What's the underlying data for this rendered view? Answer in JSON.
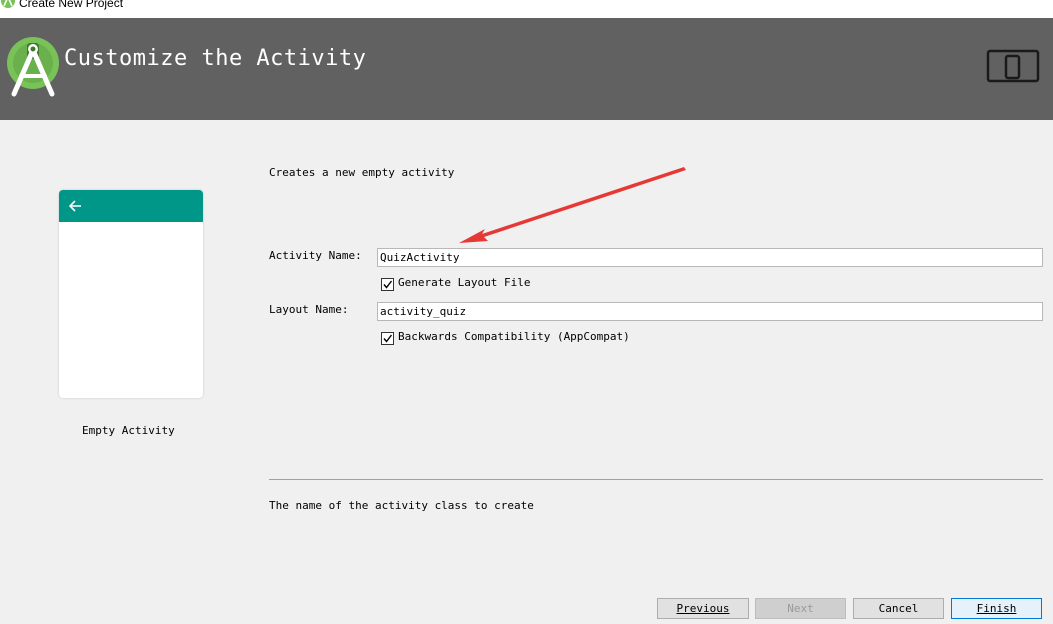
{
  "window": {
    "title": "Create New Project"
  },
  "header": {
    "title": "Customize the Activity"
  },
  "preview": {
    "label": "Empty Activity",
    "accent": "#009688"
  },
  "form": {
    "description": "Creates a new empty activity",
    "activity_name_label": "Activity Name:",
    "activity_name_value": "QuizActivity",
    "generate_layout_label": "Generate Layout File",
    "generate_layout_checked": true,
    "layout_name_label": "Layout Name:",
    "layout_name_value": "activity_quiz",
    "backwards_compat_label": "Backwards Compatibility (AppCompat)",
    "backwards_compat_checked": true,
    "help_text": "The name of the activity class to create"
  },
  "buttons": {
    "previous": "Previous",
    "next": "Next",
    "cancel": "Cancel",
    "finish": "Finish"
  },
  "colors": {
    "header_bg": "#616161",
    "annotation_arrow": "#e53935"
  }
}
